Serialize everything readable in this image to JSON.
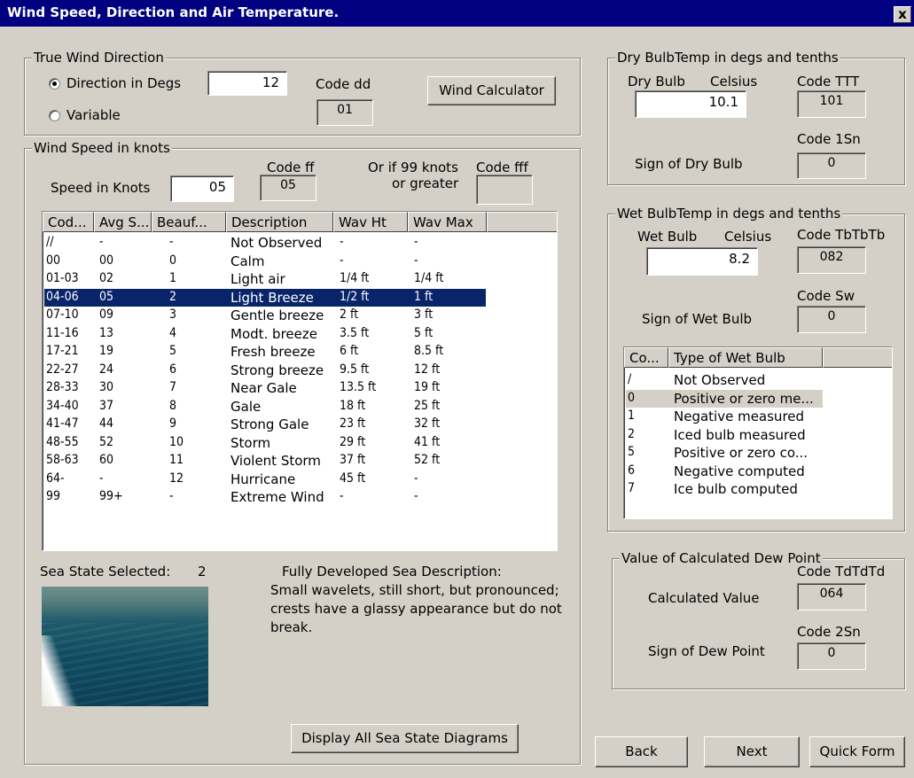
{
  "window": {
    "title": "Wind Speed, Direction and Air Temperature.",
    "close_label": "x"
  },
  "true_wind": {
    "group_label": "True Wind Direction",
    "radio_degs_label": "Direction in Degs",
    "radio_variable_label": "Variable",
    "selected": "degs",
    "degs_value": "12",
    "code_label": "Code dd",
    "code_value": "01",
    "calculator_button": "Wind Calculator"
  },
  "wind_speed": {
    "group_label": "Wind Speed in knots",
    "speed_label": "Speed in Knots",
    "speed_value": "05",
    "code_ff_label": "Code ff",
    "code_ff_value": "05",
    "or_line1": "Or if 99 knots",
    "or_line2": "or greater",
    "code_fff_label": "Code fff",
    "code_fff_value": "",
    "columns": [
      "Cod...",
      "Avg S...",
      "Beauf...",
      "Description",
      "Wav Ht",
      "Wav Max"
    ],
    "rows": [
      [
        "//",
        "-",
        "-",
        "Not Observed",
        "-",
        "-"
      ],
      [
        "00",
        "00",
        "0",
        "Calm",
        "-",
        "-"
      ],
      [
        "01-03",
        "02",
        "1",
        "Light air",
        "1/4 ft",
        "1/4 ft"
      ],
      [
        "04-06",
        "05",
        "2",
        "Light Breeze",
        "1/2 ft",
        "1 ft"
      ],
      [
        "07-10",
        "09",
        "3",
        "Gentle breeze",
        "2 ft",
        "3 ft"
      ],
      [
        "11-16",
        "13",
        "4",
        "Modt. breeze",
        "3.5 ft",
        "5 ft"
      ],
      [
        "17-21",
        "19",
        "5",
        "Fresh breeze",
        "6 ft",
        "8.5 ft"
      ],
      [
        "22-27",
        "24",
        "6",
        "Strong breeze",
        "9.5 ft",
        "12 ft"
      ],
      [
        "28-33",
        "30",
        "7",
        "Near Gale",
        "13.5 ft",
        "19 ft"
      ],
      [
        "34-40",
        "37",
        "8",
        "Gale",
        "18 ft",
        "25 ft"
      ],
      [
        "41-47",
        "44",
        "9",
        "Strong Gale",
        "23 ft",
        "32 ft"
      ],
      [
        "48-55",
        "52",
        "10",
        "Storm",
        "29 ft",
        "41 ft"
      ],
      [
        "58-63",
        "60",
        "11",
        "Violent Storm",
        "37 ft",
        "52 ft"
      ],
      [
        "64-",
        "-",
        "12",
        "Hurricane",
        "45 ft",
        "-"
      ],
      [
        "99",
        "99+",
        "-",
        "Extreme Wind",
        "-",
        "-"
      ]
    ],
    "selected_row": 3,
    "sea_state_label": "Sea State Selected:",
    "sea_state_value": "2",
    "sea_desc_title": "Fully Developed Sea Description:",
    "sea_desc_line1": "Small wavelets, still short, but pronounced;",
    "sea_desc_line2": "crests have a glassy appearance but do not",
    "sea_desc_line3": "break.",
    "display_all_button": "Display All Sea State Diagrams"
  },
  "dry_bulb": {
    "group_label": "Dry BulbTemp in degs and tenths",
    "label": "Dry Bulb",
    "unit": "Celsius",
    "value": "10.1",
    "code_ttt_label": "Code TTT",
    "code_ttt_value": "101",
    "code_sn_label": "Code 1Sn",
    "code_sn_value": "0",
    "sign_label": "Sign of Dry Bulb"
  },
  "wet_bulb": {
    "group_label": "Wet BulbTemp in degs and tenths",
    "label": "Wet Bulb",
    "unit": "Celsius",
    "value": "8.2",
    "code_label": "Code TbTbTb",
    "code_value": "082",
    "code_sw_label": "Code Sw",
    "code_sw_value": "0",
    "sign_label": "Sign of Wet Bulb",
    "columns": [
      "Co...",
      "Type of Wet Bulb"
    ],
    "rows": [
      [
        "/",
        "Not Observed"
      ],
      [
        "0",
        "Positive or zero me..."
      ],
      [
        "1",
        "Negative measured"
      ],
      [
        "2",
        "Iced bulb measured"
      ],
      [
        "5",
        "Positive or zero co..."
      ],
      [
        "6",
        "Negative computed"
      ],
      [
        "7",
        "Ice bulb computed"
      ]
    ],
    "selected_row": 1
  },
  "dew_point": {
    "group_label": "Value of Calculated Dew Point",
    "code_label": "Code TdTdTd",
    "code_value": "064",
    "calc_label": "Calculated Value",
    "code_sn_label": "Code 2Sn",
    "code_sn_value": "0",
    "sign_label": "Sign of Dew Point"
  },
  "footer": {
    "back": "Back",
    "next": "Next",
    "quick_form": "Quick Form"
  }
}
